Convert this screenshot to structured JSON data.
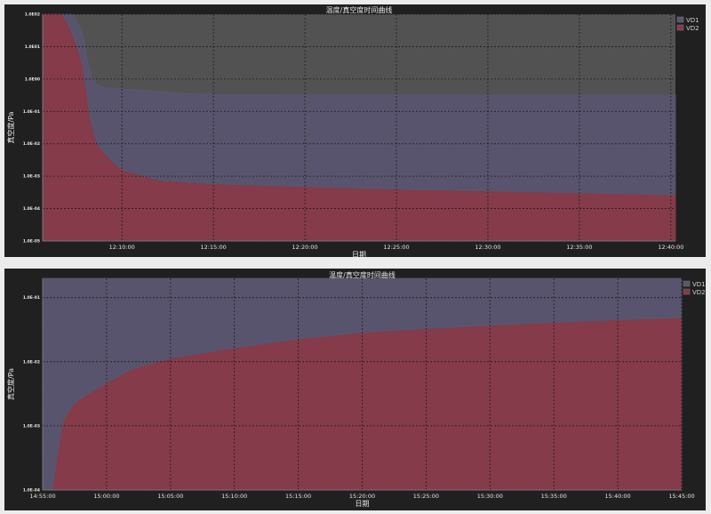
{
  "chart_data": [
    {
      "type": "area",
      "title": "温度/真空度时间曲线",
      "xlabel": "日期",
      "ylabel": "真空度/Pa",
      "yscale": "log",
      "ylim": [
        1e-05,
        100
      ],
      "y_ticks": [
        "1.0E02",
        "1.0E01",
        "1.0E00",
        "1.0E-01",
        "1.0E-02",
        "1.0E-03",
        "1.0E-04",
        "1.0E-05"
      ],
      "x_ticks": [
        "12:10:00",
        "12:15:00",
        "12:20:00",
        "12:25:00",
        "12:30:00",
        "12:35:00",
        "12:40:00"
      ],
      "xlim": [
        "12:05:40",
        "12:40:15"
      ],
      "legend_position": "top-right",
      "grid": true,
      "series": [
        {
          "name": "VD1",
          "color": "#5a5470",
          "points": [
            [
              "12:05:40",
              100
            ],
            [
              "12:07:20",
              100
            ],
            [
              "12:07:50",
              30
            ],
            [
              "12:08:05",
              5
            ],
            [
              "12:08:20",
              1.2
            ],
            [
              "12:08:40",
              0.65
            ],
            [
              "12:09:00",
              0.55
            ],
            [
              "12:10:00",
              0.5
            ],
            [
              "12:12:00",
              0.42
            ],
            [
              "12:13:20",
              0.37
            ],
            [
              "12:15:00",
              0.34
            ],
            [
              "12:20:00",
              0.33
            ],
            [
              "12:25:00",
              0.33
            ],
            [
              "12:30:00",
              0.32
            ],
            [
              "12:35:00",
              0.32
            ],
            [
              "12:40:15",
              0.32
            ]
          ]
        },
        {
          "name": "VD2",
          "color": "#8a3846",
          "points": [
            [
              "12:05:40",
              100
            ],
            [
              "12:06:40",
              100
            ],
            [
              "12:07:05",
              40
            ],
            [
              "12:07:35",
              8
            ],
            [
              "12:07:50",
              2
            ],
            [
              "12:08:00",
              0.5
            ],
            [
              "12:08:15",
              0.05
            ],
            [
              "12:08:35",
              0.01
            ],
            [
              "12:09:00",
              0.005
            ],
            [
              "12:09:30",
              0.0025
            ],
            [
              "12:10:00",
              0.0015
            ],
            [
              "12:12:00",
              0.0007
            ],
            [
              "12:15:00",
              0.00055
            ],
            [
              "12:20:00",
              0.00045
            ],
            [
              "12:25:00",
              0.00038
            ],
            [
              "12:30:00",
              0.00033
            ],
            [
              "12:35:00",
              0.00029
            ],
            [
              "12:40:15",
              0.00025
            ]
          ]
        }
      ]
    },
    {
      "type": "area",
      "title": "温度/真空度时间曲线",
      "xlabel": "日期",
      "ylabel": "真空度/Pa",
      "yscale": "log",
      "ylim": [
        0.0001,
        0.2
      ],
      "y_ticks": [
        "1.0E-01",
        "1.0E-02",
        "1.0E-03",
        "1.0E-04"
      ],
      "x_ticks": [
        "14:55:00",
        "15:00:00",
        "15:05:00",
        "15:10:00",
        "15:15:00",
        "15:20:00",
        "15:25:00",
        "15:30:00",
        "15:35:00",
        "15:40:00",
        "15:45:00"
      ],
      "xlim": [
        "14:55:00",
        "15:45:00"
      ],
      "legend_position": "top-right",
      "grid": true,
      "series": [
        {
          "name": "VD1",
          "color": "#5a5470",
          "points": [
            [
              "14:55:00",
              0.2
            ],
            [
              "15:45:00",
              0.2
            ]
          ]
        },
        {
          "name": "VD2",
          "color": "#8a3846",
          "points": [
            [
              "14:55:00",
              0.0001
            ],
            [
              "14:55:50",
              0.0001
            ],
            [
              "14:56:10",
              0.0003
            ],
            [
              "14:56:40",
              0.0012
            ],
            [
              "14:57:30",
              0.0022
            ],
            [
              "14:58:30",
              0.003
            ],
            [
              "15:00:00",
              0.0045
            ],
            [
              "15:02:00",
              0.0075
            ],
            [
              "15:05:00",
              0.011
            ],
            [
              "15:10:00",
              0.016
            ],
            [
              "15:15:00",
              0.022
            ],
            [
              "15:20:00",
              0.028
            ],
            [
              "15:25:00",
              0.032
            ],
            [
              "15:30:00",
              0.036
            ],
            [
              "15:35:00",
              0.04
            ],
            [
              "15:40:00",
              0.044
            ],
            [
              "15:45:00",
              0.047
            ]
          ]
        }
      ]
    }
  ]
}
